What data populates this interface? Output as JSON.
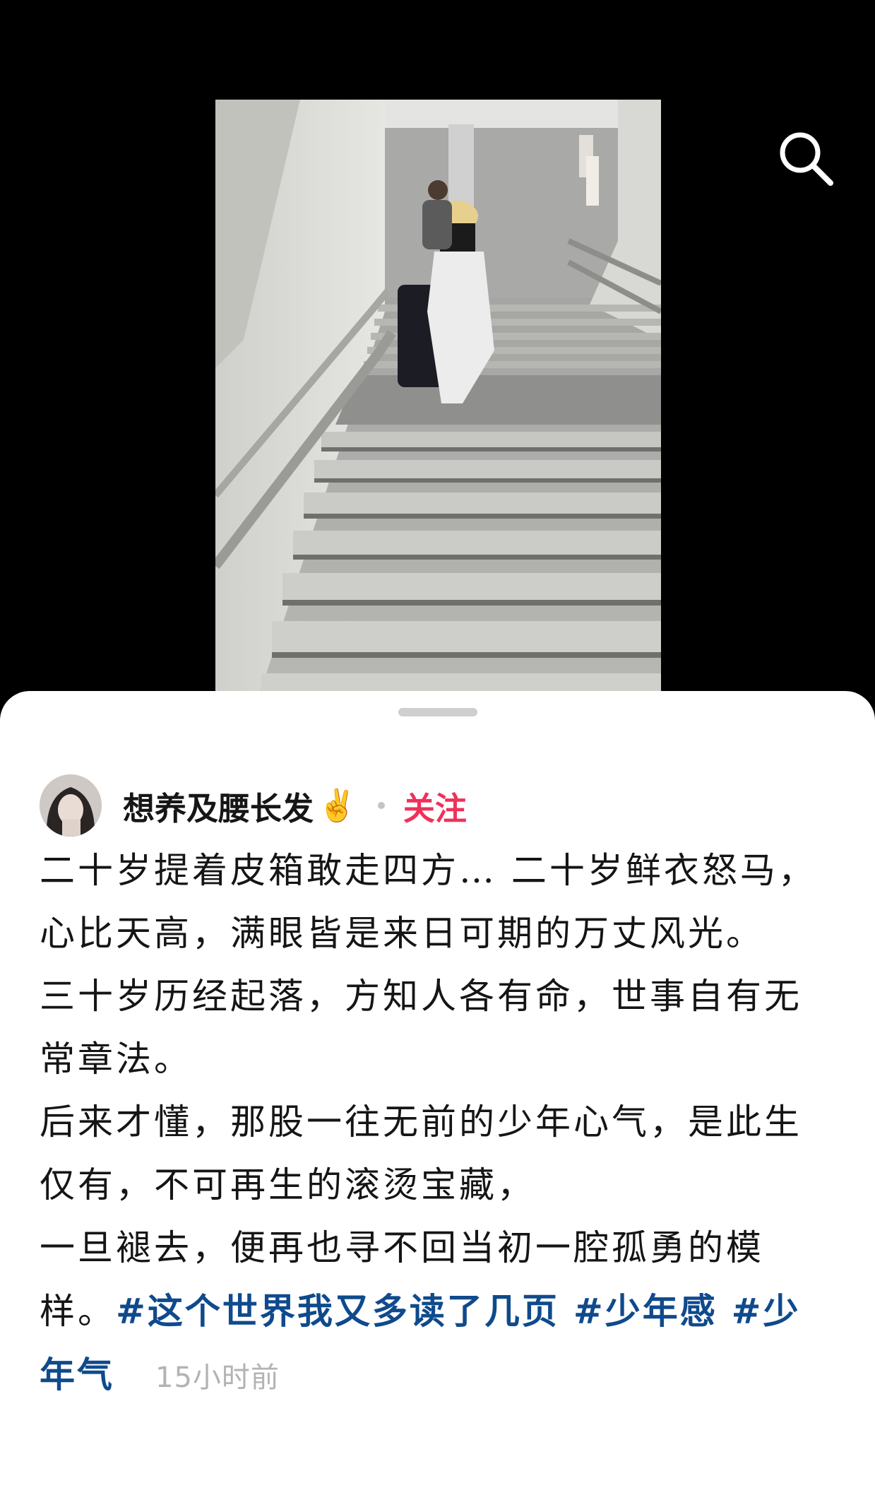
{
  "header": {
    "search_icon": "search-icon"
  },
  "video": {
    "description_icon": "video-thumbnail"
  },
  "post": {
    "author": {
      "name": "想养及腰长发",
      "emoji": "✌️",
      "follow_label": "关注"
    },
    "paragraphs": [
      "二十岁提着皮箱敢走四方… 二十岁鲜衣怒马，心比天高，满眼皆是来日可期的万丈风光。",
      "三十岁历经起落，方知人各有命，世事自有无常章法。",
      "后来才懂，那股一往无前的少年心气，是此生仅有，不可再生的滚烫宝藏，"
    ],
    "last_text": "一旦褪去，便再也寻不回当初一腔孤勇的模样。",
    "tags": [
      "#这个世界我又多读了几页",
      "#少年感",
      "#少年气"
    ],
    "time": "15小时前"
  },
  "colors": {
    "accent_follow": "#f0305a",
    "tag": "#0f4a8c",
    "time": "#b3b3b3"
  }
}
